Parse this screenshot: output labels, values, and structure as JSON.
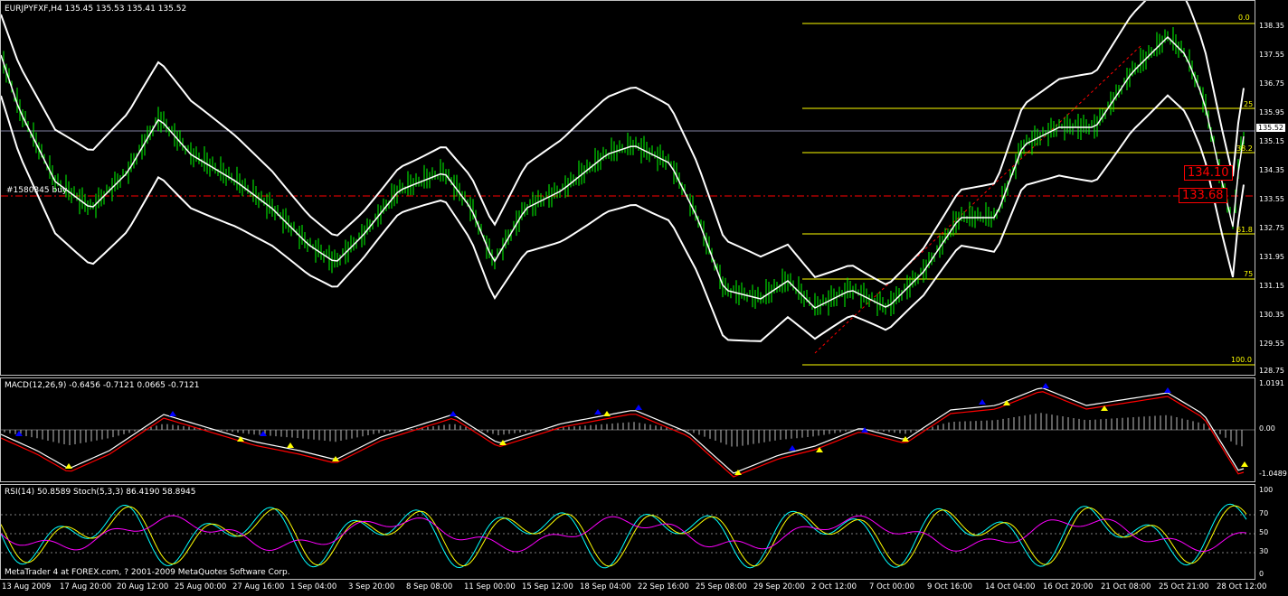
{
  "main": {
    "symbol_info": "EURJPYFXF,H4  135.45 135.53 135.41 135.52",
    "order_label": "#1580345 buy",
    "current_price_tag": "135.52",
    "price_boxes": [
      "134.10",
      "133.68"
    ],
    "price_ticks": [
      "138.35",
      "137.55",
      "136.75",
      "135.95",
      "135.15",
      "134.35",
      "133.55",
      "132.75",
      "131.95",
      "131.15",
      "130.35",
      "129.55",
      "128.75"
    ],
    "fib_levels": [
      "0.0",
      "25",
      "38.2",
      "61.8",
      "75",
      "100.0"
    ]
  },
  "macd": {
    "label": "MACD(12,26,9) -0.6456 -0.7121 0.0665 -0.7121",
    "ticks": [
      "1.0191",
      "0.00",
      "-1.0489"
    ]
  },
  "rsi": {
    "label": "RSI(14) 50.8589  Stoch(5,3,3) 86.4190 58.8945",
    "ticks": [
      "100",
      "70",
      "50",
      "30",
      "0"
    ]
  },
  "copyright": "MetaTrader 4 at FOREX.com, ? 2001-2009 MetaQuotes Software Corp.",
  "dates": [
    "13 Aug 2009",
    "17 Aug 20:00",
    "20 Aug 12:00",
    "25 Aug 00:00",
    "27 Aug 16:00",
    "1 Sep 04:00",
    "3 Sep 20:00",
    "8 Sep 08:00",
    "11 Sep 00:00",
    "15 Sep 12:00",
    "18 Sep 04:00",
    "22 Sep 16:00",
    "25 Sep 08:00",
    "29 Sep 20:00",
    "2 Oct 12:00",
    "7 Oct 00:00",
    "9 Oct 16:00",
    "14 Oct 04:00",
    "16 Oct 20:00",
    "21 Oct 08:00",
    "25 Oct 21:00",
    "28 Oct 12:00"
  ],
  "colors": {
    "candle": "#00ff00",
    "band": "#ffffff",
    "fib": "#ffff00",
    "order_line": "#ff0000",
    "macd_signal": "#ff0000",
    "rsi": "#ff00ff",
    "stoch_main": "#00ffff",
    "stoch_signal": "#ffff00"
  }
}
